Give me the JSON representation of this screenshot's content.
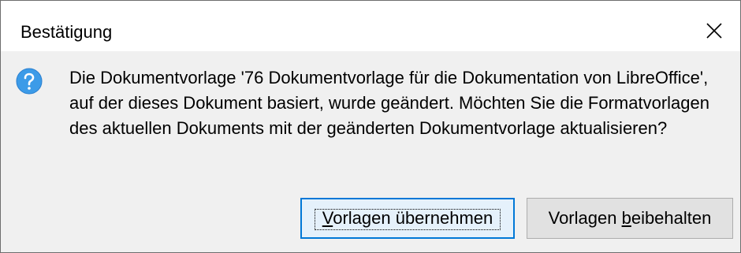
{
  "dialog": {
    "title": "Bestätigung",
    "icon": "question-icon",
    "message": "Die Dokumentvorlage '76 Dokumentvorlage für die Dokumentation von LibreOffice', auf der dieses Dokument basiert, wurde geändert. Möchten Sie die Formatvorlagen des aktuellen Dokuments mit der geänderten Dokumentvorlage aktualisieren?",
    "close_icon": "close-icon"
  },
  "buttons": {
    "update": {
      "label": "Vorlagen übernehmen",
      "accelerator": "V",
      "label_rest": "orlagen übernehmen"
    },
    "keep": {
      "label": "Vorlagen beibehalten",
      "label_pre": "Vorlagen ",
      "accelerator": "b",
      "label_post": "eibehalten"
    }
  },
  "colors": {
    "accent": "#0078d7",
    "icon_blue": "#3c9be8",
    "background": "#f0f0f0"
  }
}
